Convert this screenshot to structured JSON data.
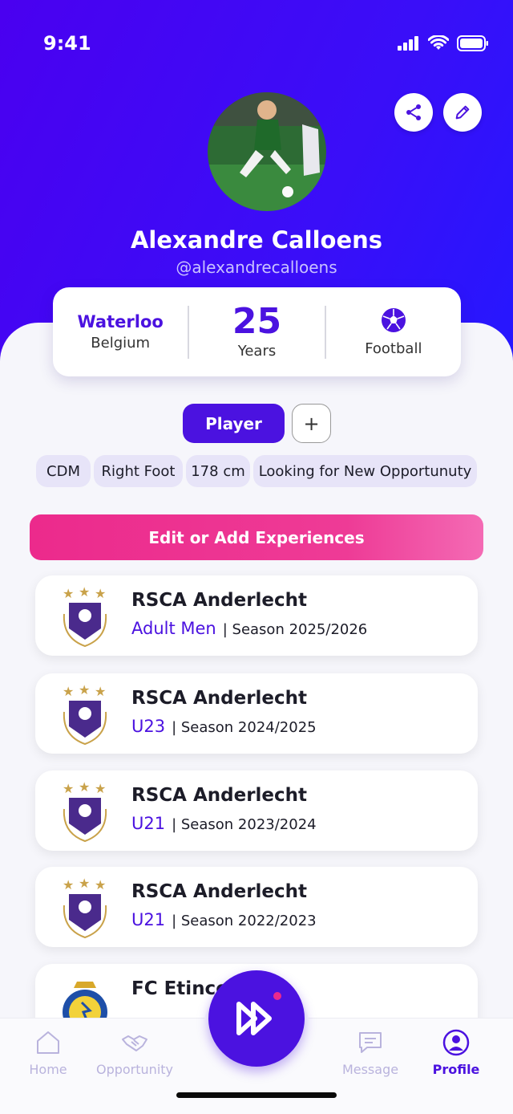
{
  "status": {
    "time": "9:41"
  },
  "profile": {
    "name": "Alexandre Calloens",
    "handle": "@alexandrecalloens"
  },
  "stats": {
    "city": "Waterloo",
    "country": "Belgium",
    "age": "25",
    "age_unit": "Years",
    "sport": "Football"
  },
  "roles": {
    "active": "Player",
    "add": "+"
  },
  "tags": [
    "CDM",
    "Right Foot",
    "178 cm",
    "Looking for New Opportunuty"
  ],
  "edit_button": "Edit or Add Experiences",
  "experiences": [
    {
      "club": "RSCA Anderlecht",
      "team": "Adult Men",
      "season": "| Season 2025/2026"
    },
    {
      "club": "RSCA Anderlecht",
      "team": "U23",
      "season": "| Season 2024/2025"
    },
    {
      "club": "RSCA Anderlecht",
      "team": "U21",
      "season": "| Season 2023/2024"
    },
    {
      "club": "RSCA Anderlecht",
      "team": "U21",
      "season": "| Season 2022/2023"
    },
    {
      "club": "FC Etince",
      "team": "",
      "season": ""
    }
  ],
  "nav": {
    "home": "Home",
    "opportunity": "Opportunity",
    "message": "Message",
    "profile": "Profile"
  },
  "colors": {
    "brand": "#4b12e0",
    "accent": "#ec2a8c",
    "nav_inactive": "#b9b3dd"
  }
}
